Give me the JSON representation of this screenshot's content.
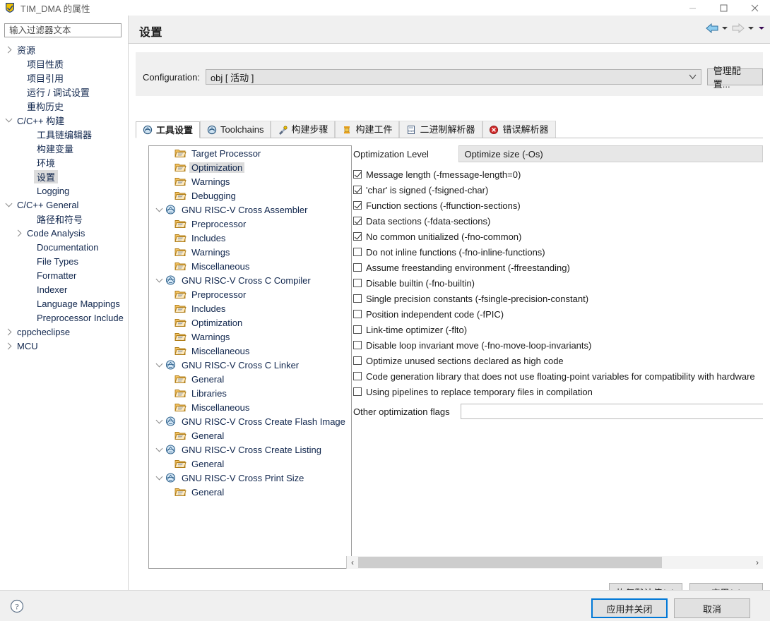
{
  "window": {
    "title": "TIM_DMA 的属性",
    "app_icon": "eclipse-shield-icon",
    "minimize": "–",
    "maximize": "▢",
    "close": "✕"
  },
  "sidebar": {
    "filter": {
      "value": "",
      "placeholder": "输入过滤器文本"
    },
    "items": [
      {
        "label": "资源",
        "indent": 0,
        "twisty": "right",
        "selected": false
      },
      {
        "label": "项目性质",
        "indent": 1,
        "twisty": "none",
        "selected": false
      },
      {
        "label": "项目引用",
        "indent": 1,
        "twisty": "none",
        "selected": false
      },
      {
        "label": "运行 / 调试设置",
        "indent": 1,
        "twisty": "none",
        "selected": false
      },
      {
        "label": "重构历史",
        "indent": 1,
        "twisty": "none",
        "selected": false
      },
      {
        "label": "C/C++ 构建",
        "indent": 0,
        "twisty": "down",
        "selected": false
      },
      {
        "label": "工具链编辑器",
        "indent": 2,
        "twisty": "none",
        "selected": false
      },
      {
        "label": "构建变量",
        "indent": 2,
        "twisty": "none",
        "selected": false
      },
      {
        "label": "环境",
        "indent": 2,
        "twisty": "none",
        "selected": false
      },
      {
        "label": "设置",
        "indent": 2,
        "twisty": "none",
        "selected": true
      },
      {
        "label": "Logging",
        "indent": 2,
        "twisty": "none",
        "selected": false
      },
      {
        "label": "C/C++ General",
        "indent": 0,
        "twisty": "down",
        "selected": false
      },
      {
        "label": "路径和符号",
        "indent": 2,
        "twisty": "none",
        "selected": false
      },
      {
        "label": "Code Analysis",
        "indent": 1,
        "twisty": "right",
        "selected": false
      },
      {
        "label": "Documentation",
        "indent": 2,
        "twisty": "none",
        "selected": false
      },
      {
        "label": "File Types",
        "indent": 2,
        "twisty": "none",
        "selected": false
      },
      {
        "label": "Formatter",
        "indent": 2,
        "twisty": "none",
        "selected": false
      },
      {
        "label": "Indexer",
        "indent": 2,
        "twisty": "none",
        "selected": false
      },
      {
        "label": "Language Mappings",
        "indent": 2,
        "twisty": "none",
        "selected": false
      },
      {
        "label": "Preprocessor Include",
        "indent": 2,
        "twisty": "none",
        "selected": false
      },
      {
        "label": "cppcheclipse",
        "indent": 0,
        "twisty": "right",
        "selected": false
      },
      {
        "label": "MCU",
        "indent": 0,
        "twisty": "right",
        "selected": false
      }
    ],
    "hscroll": {
      "left_arrow": "‹",
      "right_arrow": "›"
    }
  },
  "header": {
    "title": "设置",
    "back_icon": "back-arrow-icon",
    "forward_icon": "forward-arrow-icon",
    "menu_icon": "dropdown-caret-icon"
  },
  "configuration": {
    "label": "Configuration:",
    "value": "obj  [ 活动 ]",
    "manage_button": "管理配置..."
  },
  "tabs": [
    {
      "label": "工具设置",
      "icon": "tool-settings-icon",
      "active": true
    },
    {
      "label": "Toolchains",
      "icon": "toolchains-icon",
      "active": false
    },
    {
      "label": "构建步骤",
      "icon": "build-steps-icon",
      "active": false
    },
    {
      "label": "构建工件",
      "icon": "build-artifact-icon",
      "active": false
    },
    {
      "label": "二进制解析器",
      "icon": "binary-parser-icon",
      "active": false
    },
    {
      "label": "错误解析器",
      "icon": "error-parser-icon",
      "active": false
    }
  ],
  "tool_tree": [
    {
      "label": "Target Processor",
      "indent": 1,
      "twisty": "none",
      "icon": "folder-icon",
      "selected": false
    },
    {
      "label": "Optimization",
      "indent": 1,
      "twisty": "none",
      "icon": "folder-icon",
      "selected": true
    },
    {
      "label": "Warnings",
      "indent": 1,
      "twisty": "none",
      "icon": "folder-icon",
      "selected": false
    },
    {
      "label": "Debugging",
      "indent": 1,
      "twisty": "none",
      "icon": "folder-icon",
      "selected": false
    },
    {
      "label": "GNU RISC-V Cross Assembler",
      "indent": 0,
      "twisty": "down",
      "icon": "tool-icon",
      "selected": false
    },
    {
      "label": "Preprocessor",
      "indent": 1,
      "twisty": "none",
      "icon": "folder-icon",
      "selected": false
    },
    {
      "label": "Includes",
      "indent": 1,
      "twisty": "none",
      "icon": "folder-icon",
      "selected": false
    },
    {
      "label": "Warnings",
      "indent": 1,
      "twisty": "none",
      "icon": "folder-icon",
      "selected": false
    },
    {
      "label": "Miscellaneous",
      "indent": 1,
      "twisty": "none",
      "icon": "folder-icon",
      "selected": false
    },
    {
      "label": "GNU RISC-V Cross C Compiler",
      "indent": 0,
      "twisty": "down",
      "icon": "tool-icon",
      "selected": false
    },
    {
      "label": "Preprocessor",
      "indent": 1,
      "twisty": "none",
      "icon": "folder-icon",
      "selected": false
    },
    {
      "label": "Includes",
      "indent": 1,
      "twisty": "none",
      "icon": "folder-icon",
      "selected": false
    },
    {
      "label": "Optimization",
      "indent": 1,
      "twisty": "none",
      "icon": "folder-icon",
      "selected": false
    },
    {
      "label": "Warnings",
      "indent": 1,
      "twisty": "none",
      "icon": "folder-icon",
      "selected": false
    },
    {
      "label": "Miscellaneous",
      "indent": 1,
      "twisty": "none",
      "icon": "folder-icon",
      "selected": false
    },
    {
      "label": "GNU RISC-V Cross C Linker",
      "indent": 0,
      "twisty": "down",
      "icon": "tool-icon",
      "selected": false
    },
    {
      "label": "General",
      "indent": 1,
      "twisty": "none",
      "icon": "folder-icon",
      "selected": false
    },
    {
      "label": "Libraries",
      "indent": 1,
      "twisty": "none",
      "icon": "folder-icon",
      "selected": false
    },
    {
      "label": "Miscellaneous",
      "indent": 1,
      "twisty": "none",
      "icon": "folder-icon",
      "selected": false
    },
    {
      "label": "GNU RISC-V Cross Create Flash Image",
      "indent": 0,
      "twisty": "down",
      "icon": "tool-icon",
      "selected": false
    },
    {
      "label": "General",
      "indent": 1,
      "twisty": "none",
      "icon": "folder-icon",
      "selected": false
    },
    {
      "label": "GNU RISC-V Cross Create Listing",
      "indent": 0,
      "twisty": "down",
      "icon": "tool-icon",
      "selected": false
    },
    {
      "label": "General",
      "indent": 1,
      "twisty": "none",
      "icon": "folder-icon",
      "selected": false
    },
    {
      "label": "GNU RISC-V Cross Print Size",
      "indent": 0,
      "twisty": "down",
      "icon": "tool-icon",
      "selected": false
    },
    {
      "label": "General",
      "indent": 1,
      "twisty": "none",
      "icon": "folder-icon",
      "selected": false
    }
  ],
  "options": {
    "level_label": "Optimization Level",
    "level_value": "Optimize size (-Os)",
    "checkboxes": [
      {
        "label": "Message length (-fmessage-length=0)",
        "checked": true
      },
      {
        "label": "'char' is signed (-fsigned-char)",
        "checked": true
      },
      {
        "label": "Function sections (-ffunction-sections)",
        "checked": true
      },
      {
        "label": "Data sections (-fdata-sections)",
        "checked": true
      },
      {
        "label": "No common unitialized (-fno-common)",
        "checked": true
      },
      {
        "label": "Do not inline functions (-fno-inline-functions)",
        "checked": false
      },
      {
        "label": "Assume freestanding environment (-ffreestanding)",
        "checked": false
      },
      {
        "label": "Disable builtin (-fno-builtin)",
        "checked": false
      },
      {
        "label": "Single precision constants (-fsingle-precision-constant)",
        "checked": false
      },
      {
        "label": "Position independent code (-fPIC)",
        "checked": false
      },
      {
        "label": "Link-time optimizer (-flto)",
        "checked": false
      },
      {
        "label": "Disable loop invariant move (-fno-move-loop-invariants)",
        "checked": false
      },
      {
        "label": "Optimize unused sections declared as high code",
        "checked": false
      },
      {
        "label": "Code generation library that does not use floating-point variables for compatibility with hardware",
        "checked": false
      },
      {
        "label": "Using pipelines to replace temporary files in compilation",
        "checked": false
      }
    ],
    "other_label": "Other optimization flags",
    "other_value": "",
    "hscroll": {
      "left_arrow": "‹",
      "right_arrow": "›"
    }
  },
  "buttons": {
    "restore_defaults": "恢复默认值(D)",
    "apply": "应用(A)",
    "apply_and_close": "应用并关闭",
    "cancel": "取消",
    "help_icon": "help-question-icon"
  },
  "colors": {
    "accent": "#0078d7",
    "panel": "#f0f0f0",
    "tree_text": "#10264d",
    "selection": "#dcdcdc"
  }
}
